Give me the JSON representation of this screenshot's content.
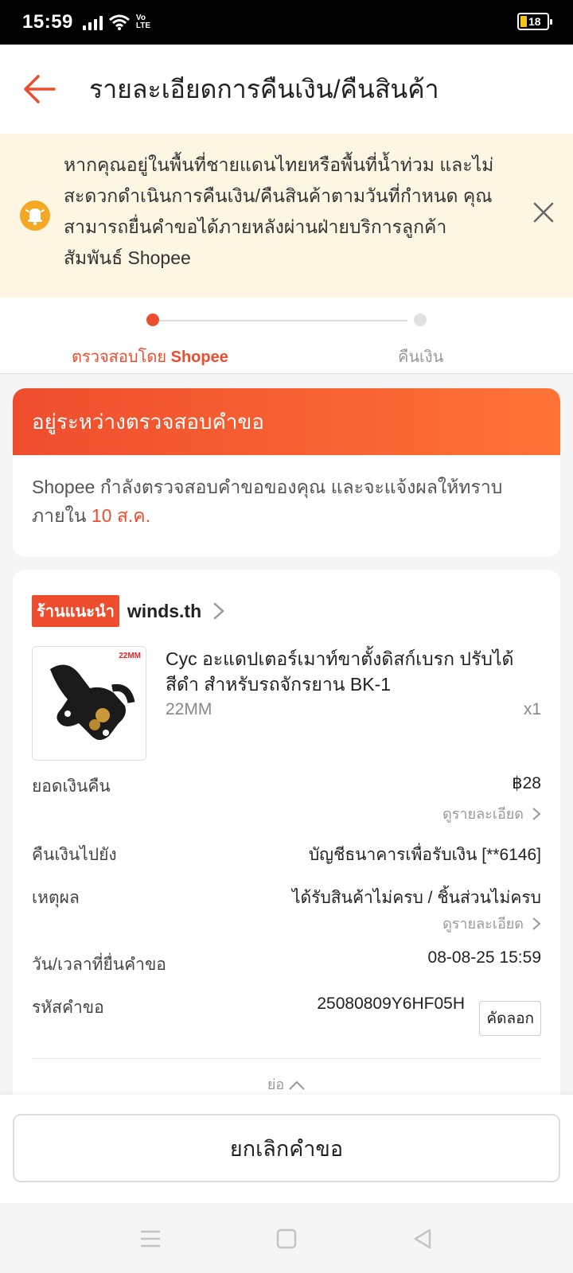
{
  "status_bar": {
    "time": "15:59",
    "network": "Vo LTE",
    "battery": "18"
  },
  "header": {
    "title": "รายละเอียดการคืนเงิน/คืนสินค้า"
  },
  "notice": {
    "line1": "หากคุณอยู่ในพื้นที่ชายแดนไทยหรือพื้นที่น้ำท่วม และไม่",
    "line2": "สะดวกดำเนินการคืนเงิน/คืนสินค้าตามวันที่กำหนด คุณ",
    "line3": "สามารถยื่นคำขอได้ภายหลังผ่านฝ่ายบริการลูกค้า",
    "line4": "สัมพันธ์ Shopee"
  },
  "steps": {
    "step1_prefix": "ตรวจสอบโดย ",
    "step1_brand": "Shopee",
    "step2": "คืนเงิน"
  },
  "status_card": {
    "banner": "อยู่ระหว่างตรวจสอบคำขอ",
    "desc_line1": "Shopee กำลังตรวจสอบคำขอของคุณ และจะแจ้งผลให้ทราบ",
    "desc_line2": "ภายใน ",
    "deadline": "10 ส.ค."
  },
  "shop": {
    "badge": "ร้านแนะนำ",
    "name": "winds.th"
  },
  "product": {
    "image_tag": "22MM",
    "title": "Cyc อะแดปเตอร์เมาท์ขาตั้งดิสก์เบรก ปรับได้ สีดำ สำหรับรถจักรยาน BK-1",
    "variant": "22MM",
    "qty": "x1"
  },
  "details": {
    "refund_amount_label": "ยอดเงินคืน",
    "refund_amount_value": "฿28",
    "view_details": "ดูรายละเอียด",
    "refund_to_label": "คืนเงินไปยัง",
    "refund_to_value": "บัญชีธนาคารเพื่อรับเงิน [**6146]",
    "reason_label": "เหตุผล",
    "reason_value": "ได้รับสินค้าไม่ครบ / ชิ้นส่วนไม่ครบ",
    "submitted_label": "วัน/เวลาที่ยื่นคำขอ",
    "submitted_value": "08-08-25 15:59",
    "request_id_label": "รหัสคำขอ",
    "request_id_value": "25080809Y6HF05H",
    "copy_label": "คัดลอก",
    "collapse_label": "ย่อ"
  },
  "bottom": {
    "cancel_label": "ยกเลิกคำขอ"
  },
  "colors": {
    "accent": "#ee4d2d",
    "notice_bg": "#fdf6e3",
    "bell": "#f5a623"
  }
}
